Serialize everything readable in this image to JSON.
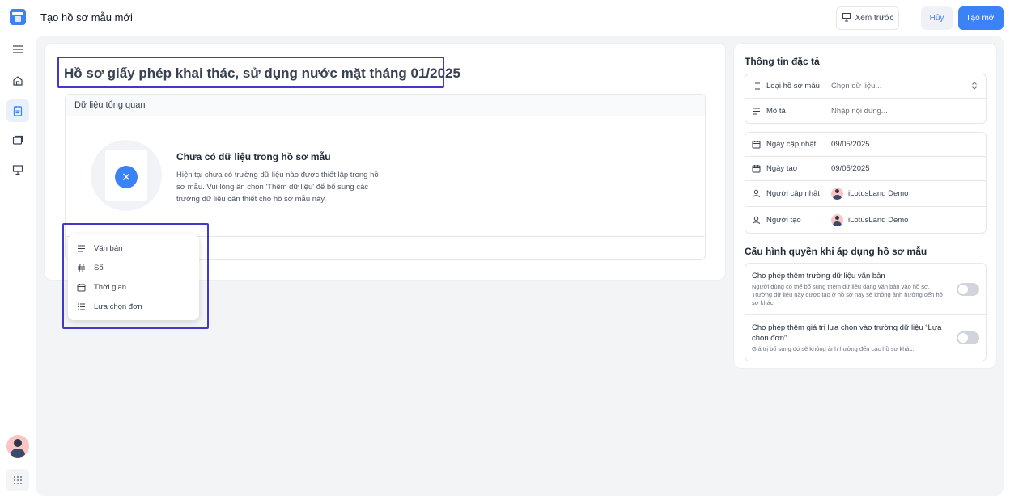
{
  "header": {
    "title": "Tạo hồ sơ mẫu mới",
    "preview_label": "Xem trước",
    "cancel_label": "Hủy",
    "create_label": "Tạo mới"
  },
  "sidebar": {
    "items": [
      {
        "icon": "menu-icon"
      },
      {
        "icon": "home-icon"
      },
      {
        "icon": "document-icon",
        "active": true
      },
      {
        "icon": "folders-icon"
      },
      {
        "icon": "presentation-icon"
      }
    ]
  },
  "profile": {
    "title": "Hồ sơ giấy phép khai thác, sử dụng nước mặt tháng 01/2025"
  },
  "overview": {
    "header": "Dữ liệu tổng quan",
    "empty_title": "Chưa có dữ liệu trong hồ sơ mẫu",
    "empty_desc": "Hiện tại chưa có trường dữ liệu nào được thiết lập trong hồ sơ mẫu. Vui lòng ấn chọn 'Thêm dữ liệu' để bổ sung các trường dữ liệu cần thiết cho hồ sơ mẫu này."
  },
  "field_menu": {
    "items": [
      {
        "label": "Văn bản",
        "icon": "text-lines-icon"
      },
      {
        "label": "Số",
        "icon": "hash-icon"
      },
      {
        "label": "Thời gian",
        "icon": "calendar-icon"
      },
      {
        "label": "Lựa chọn đơn",
        "icon": "list-icon"
      }
    ]
  },
  "spec": {
    "title": "Thông tin đặc tả",
    "type_label": "Loại hồ sơ mẫu",
    "type_placeholder": "Chọn dữ liệu...",
    "desc_label": "Mô tả",
    "desc_placeholder": "Nhập nội dung...",
    "updated_label": "Ngày cập nhật",
    "updated_value": "09/05/2025",
    "created_label": "Ngày tạo",
    "created_value": "09/05/2025",
    "updater_label": "Người cập nhật",
    "updater_value": "iLotusLand Demo",
    "creator_label": "Người tạo",
    "creator_value": "iLotusLand Demo"
  },
  "permissions": {
    "title": "Cấu hình quyền khi áp dụng hồ sơ mẫu",
    "items": [
      {
        "title": "Cho phép thêm trường dữ liệu văn bản",
        "desc": "Người dùng có thể bổ sung thêm dữ liệu dạng văn bản vào hồ sơ. Trường dữ liệu này được tạo ở hồ sơ này sẽ không ảnh hưởng đến hồ sơ khác.",
        "enabled": false
      },
      {
        "title": "Cho phép thêm giá trị lựa chọn vào trường dữ liệu “Lựa chọn đơn”",
        "desc": "Giá trị bổ sung đó sẽ không ảnh hưởng đến các hồ sơ khác.",
        "enabled": false
      }
    ]
  },
  "colors": {
    "accent": "#3b82f6",
    "highlight": "#4338ca"
  }
}
